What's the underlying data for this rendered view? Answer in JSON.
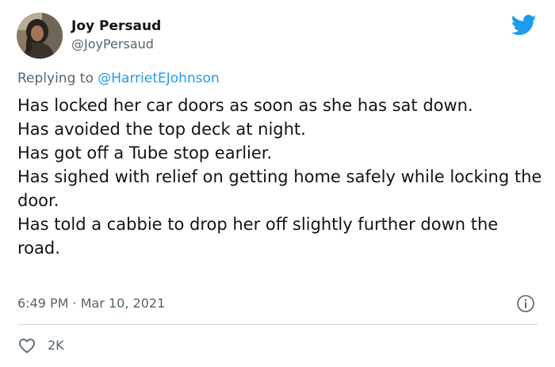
{
  "author": {
    "display_name": "Joy Persaud",
    "handle": "@JoyPersaud",
    "avatar": "profile-photo"
  },
  "brand": {
    "icon": "twitter-bird-icon",
    "color": "#1d9bf0"
  },
  "reply": {
    "prefix": "Replying to ",
    "mention": "@HarrietEJohnson"
  },
  "tweet": {
    "lines": [
      "Has locked her car doors as soon as she has sat down.",
      "Has avoided the top deck at night.",
      "Has got off a Tube stop earlier.",
      "Has sighed with relief on getting home safely while locking the door.",
      "Has told a cabbie to drop her off slightly further down the road."
    ]
  },
  "meta": {
    "timestamp": "6:49 PM · Mar 10, 2021",
    "info_icon": "info-icon"
  },
  "actions": {
    "like_icon": "heart-icon",
    "like_count": "2K"
  },
  "colors": {
    "text": "#0f1419",
    "secondary": "#536471",
    "link": "#1d9bf0",
    "divider": "#cfd9de"
  }
}
